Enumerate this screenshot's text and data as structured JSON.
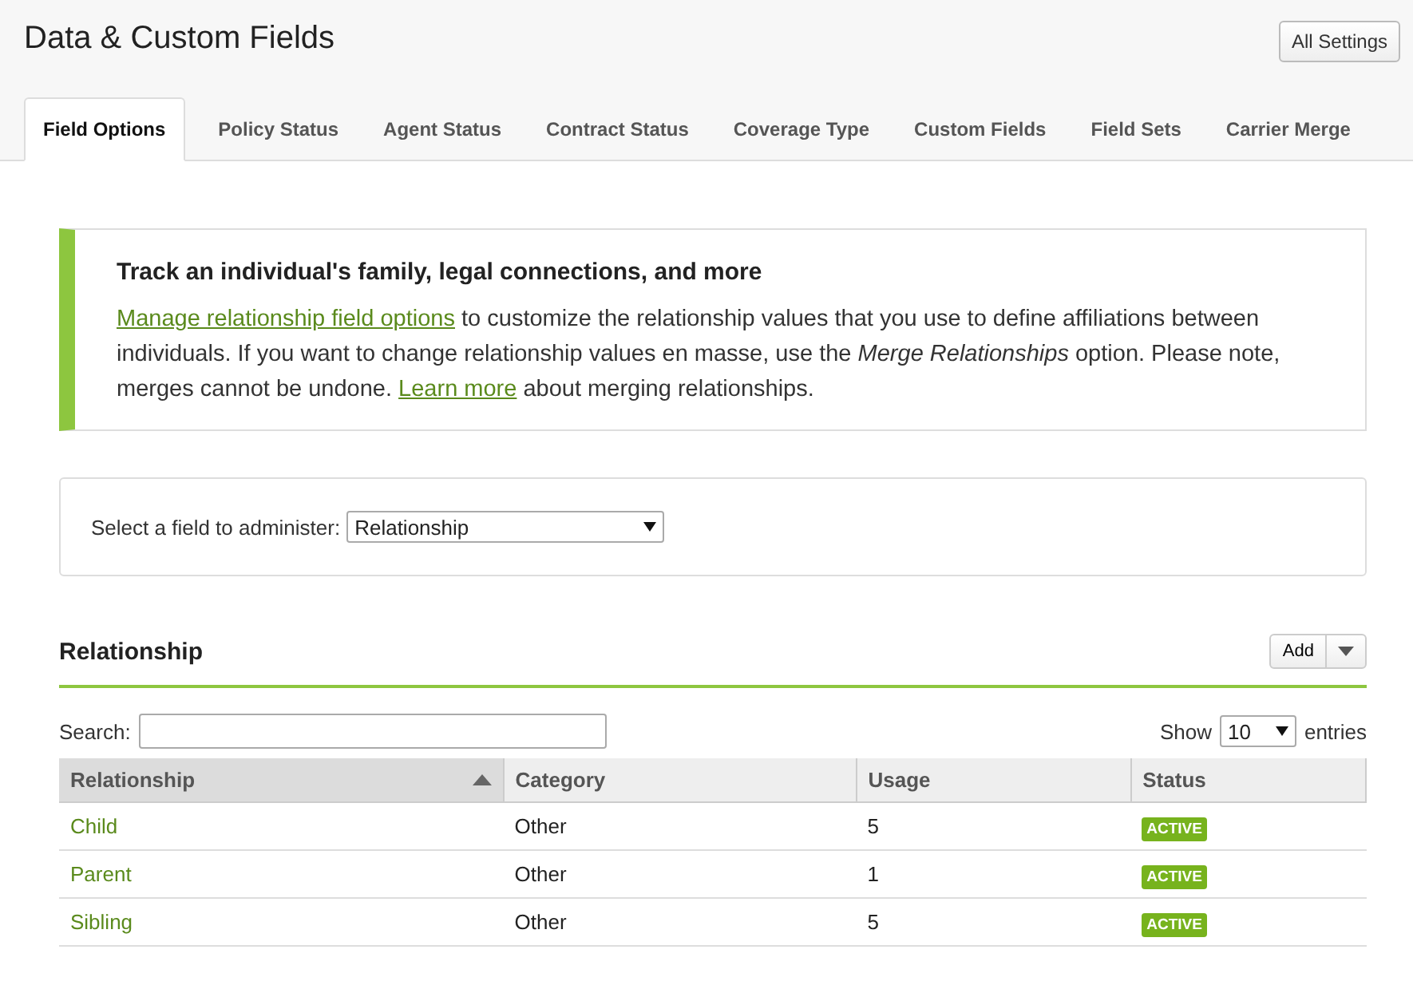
{
  "page": {
    "title": "Data & Custom Fields",
    "settings_button": "All Settings"
  },
  "tabs": [
    {
      "label": "Field Options",
      "selected": true
    },
    {
      "label": "Policy Status",
      "selected": false
    },
    {
      "label": "Agent Status",
      "selected": false
    },
    {
      "label": "Contract Status",
      "selected": false
    },
    {
      "label": "Coverage Type",
      "selected": false
    },
    {
      "label": "Custom Fields",
      "selected": false
    },
    {
      "label": "Field Sets",
      "selected": false
    },
    {
      "label": "Carrier Merge",
      "selected": false
    }
  ],
  "info_box": {
    "heading": "Track an individual's family, legal connections, and more",
    "link_1": "Manage relationship field options",
    "text_1": " to customize the relationship values that you use to define affiliations between individuals. If you want to change relationship values en masse, use the *Merge Relationships* option. Please note, merges cannot be undone. ",
    "link_2": "Learn more",
    "text_2": " about merging relationships."
  },
  "field_select": {
    "label": "Select a field to administer:",
    "value": "Relationship"
  },
  "section": {
    "title": "Relationship",
    "add_button": "Add"
  },
  "table_controls": {
    "search_label": "Search:",
    "show_label": "Show",
    "page_size": "10",
    "entries_label": "entries"
  },
  "table": {
    "columns": [
      {
        "label": "Relationship",
        "sorted": true
      },
      {
        "label": "Category",
        "sorted": false
      },
      {
        "label": "Usage",
        "sorted": false
      },
      {
        "label": "Status",
        "sorted": false
      }
    ],
    "rows": [
      {
        "relationship": "Child",
        "category": "Other",
        "usage": "5",
        "status": "ACTIVE"
      },
      {
        "relationship": "Parent",
        "category": "Other",
        "usage": "1",
        "status": "ACTIVE"
      },
      {
        "relationship": "Sibling",
        "category": "Other",
        "usage": "5",
        "status": "ACTIVE"
      }
    ]
  }
}
